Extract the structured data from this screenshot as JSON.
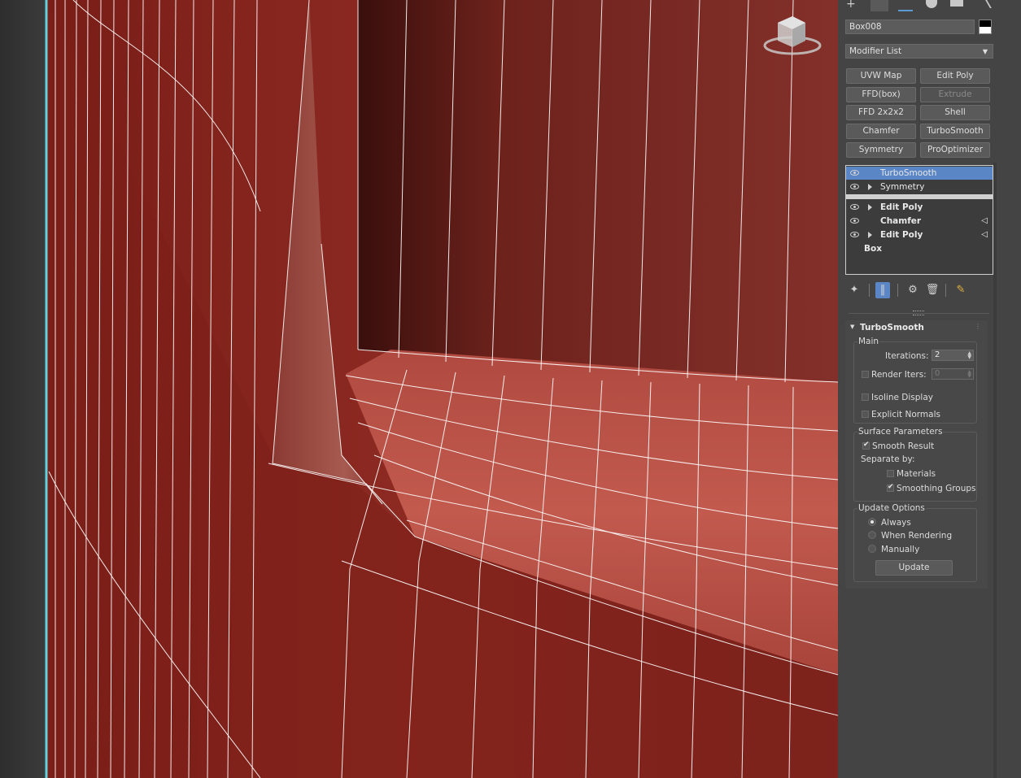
{
  "object": {
    "name": "Box008",
    "color_swatch": "#000000"
  },
  "modifier_list": {
    "label": "Modifier List"
  },
  "modifier_buttons": [
    {
      "label": "UVW Map",
      "enabled": true
    },
    {
      "label": "Edit Poly",
      "enabled": true
    },
    {
      "label": "FFD(box)",
      "enabled": true
    },
    {
      "label": "Extrude",
      "enabled": false
    },
    {
      "label": "FFD 2x2x2",
      "enabled": true
    },
    {
      "label": "Shell",
      "enabled": true
    },
    {
      "label": "Chamfer",
      "enabled": true
    },
    {
      "label": "TurboSmooth",
      "enabled": true
    },
    {
      "label": "Symmetry",
      "enabled": true
    },
    {
      "label": "ProOptimizer",
      "enabled": true
    }
  ],
  "stack": [
    {
      "label": "TurboSmooth",
      "selected": true,
      "eye": true,
      "expand": false,
      "bold": false
    },
    {
      "label": "Symmetry",
      "selected": false,
      "eye": true,
      "expand": true,
      "bold": false
    },
    {
      "label": "Edit Poly",
      "selected": false,
      "eye": true,
      "expand": true,
      "bold": true
    },
    {
      "label": "Chamfer",
      "selected": false,
      "eye": true,
      "expand": false,
      "bold": true
    },
    {
      "label": "Edit Poly",
      "selected": false,
      "eye": true,
      "expand": true,
      "bold": true
    },
    {
      "label": "Box",
      "selected": false,
      "eye": false,
      "expand": false,
      "bold": true
    }
  ],
  "rollout": {
    "title": "TurboSmooth",
    "main": {
      "label": "Main",
      "iterations_label": "Iterations:",
      "iterations_value": "2",
      "render_iters_label": "Render Iters:",
      "render_iters_value": "0",
      "render_iters_checked": false,
      "isoline_label": "Isoline Display",
      "isoline_checked": false,
      "explicit_normals_label": "Explicit Normals",
      "explicit_normals_checked": false
    },
    "surface": {
      "label": "Surface Parameters",
      "smooth_result_label": "Smooth Result",
      "smooth_result_checked": true,
      "separate_by_label": "Separate by:",
      "materials_label": "Materials",
      "materials_checked": false,
      "smoothing_groups_label": "Smoothing Groups",
      "smoothing_groups_checked": true
    },
    "update": {
      "label": "Update Options",
      "always_label": "Always",
      "when_rendering_label": "When Rendering",
      "manually_label": "Manually",
      "selected": "Always",
      "update_button": "Update"
    }
  },
  "colors": {
    "mesh": "#8a2420",
    "wire": "#ffffff",
    "selection_edge": "#5fd3e0",
    "stack_selected": "#5b86c5"
  }
}
